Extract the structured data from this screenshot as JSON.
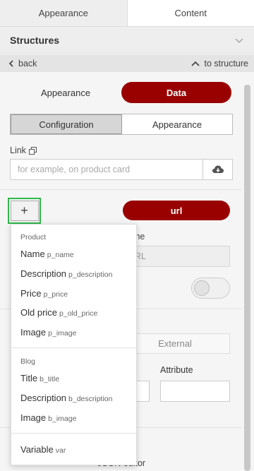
{
  "top_tabs": [
    {
      "label": "Appearance"
    },
    {
      "label": "Content"
    }
  ],
  "section": {
    "title": "Structures"
  },
  "nav": {
    "back": "back",
    "to_structure": "to structure"
  },
  "mode": {
    "appearance": "Appearance",
    "data": "Data"
  },
  "segments": {
    "configuration": "Configuration",
    "appearance": "Appearance"
  },
  "link": {
    "label": "Link",
    "placeholder": "for example, on product card"
  },
  "url_pill": "url",
  "name_field": {
    "label_partial": "me",
    "value_partial": "RL"
  },
  "external": "External",
  "attribute": "Attribute",
  "json_editor": "JSON editor",
  "plus_label": "+",
  "dropdown": {
    "groups": [
      {
        "title": "Product",
        "items": [
          {
            "label": "Name",
            "code": "p_name"
          },
          {
            "label": "Description",
            "code": "p_description"
          },
          {
            "label": "Price",
            "code": "p_price"
          },
          {
            "label": "Old price",
            "code": "p_old_price"
          },
          {
            "label": "Image",
            "code": "p_image"
          }
        ]
      },
      {
        "title": "Blog",
        "items": [
          {
            "label": "Title",
            "code": "b_title"
          },
          {
            "label": "Description",
            "code": "b_description"
          },
          {
            "label": "Image",
            "code": "b_image"
          }
        ]
      },
      {
        "title": "",
        "items": [
          {
            "label": "Variable",
            "code": "var"
          }
        ]
      }
    ]
  },
  "colors": {
    "accent": "#990000",
    "highlight": "#2eb84b"
  }
}
